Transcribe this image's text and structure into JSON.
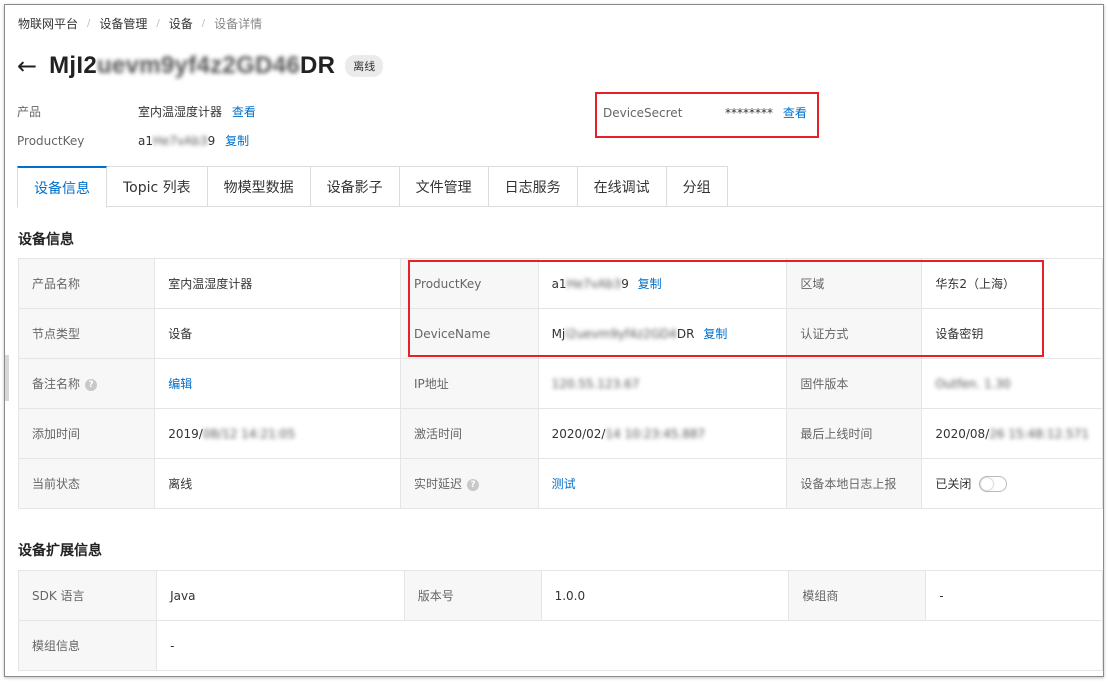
{
  "breadcrumb": [
    "物联网平台",
    "设备管理",
    "设备",
    "设备详情"
  ],
  "header": {
    "title_start": "MjI2",
    "title_blurred": "uevm9yf4z2GD46",
    "title_end": "DR",
    "status": "离线"
  },
  "meta": {
    "product_label": "产品",
    "product_value": "室内温湿度计器",
    "product_link": "查看",
    "productkey_label": "ProductKey",
    "productkey_value_start": "a1",
    "productkey_value_blurred": "He7vAb3",
    "productkey_value_end": "9",
    "productkey_link": "复制",
    "devicesecret_label": "DeviceSecret",
    "devicesecret_value": "********",
    "devicesecret_link": "查看"
  },
  "tabs": [
    "设备信息",
    "Topic 列表",
    "物模型数据",
    "设备影子",
    "文件管理",
    "日志服务",
    "在线调试",
    "分组"
  ],
  "device_info": {
    "title": "设备信息",
    "row1": {
      "l1": "产品名称",
      "v1": "室内温湿度计器",
      "l2": "ProductKey",
      "v2_start": "a1",
      "v2_blur": "He7vAb3",
      "v2_end": "9",
      "v2_link": "复制",
      "l3": "区域",
      "v3": "华东2（上海）"
    },
    "row2": {
      "l1": "节点类型",
      "v1": "设备",
      "l2": "DeviceName",
      "v2_start": "Mj",
      "v2_blur": "I2uevm9yf4z2GD4",
      "v2_end": "DR",
      "v2_link": "复制",
      "l3": "认证方式",
      "v3": "设备密钥"
    },
    "row3": {
      "l1": "备注名称",
      "v1": "编辑",
      "l2": "IP地址",
      "v2_blur": "120.55.123.67",
      "l3": "固件版本",
      "v3_blur": "Outfen. 1.30"
    },
    "row4": {
      "l1": "添加时间",
      "v1_start": "2019/",
      "v1_blur": "08/12 14:21:05",
      "l2": "激活时间",
      "v2_start": "2020/02/",
      "v2_blur": "14 10:23:45.887",
      "l3": "最后上线时间",
      "v3_start": "2020/08/",
      "v3_blur": "26 15:48:12.571"
    },
    "row5": {
      "l1": "当前状态",
      "v1": "离线",
      "l2": "实时延迟",
      "v2": "测试",
      "l3": "设备本地日志上报",
      "v3": "已关闭"
    }
  },
  "ext_info": {
    "title": "设备扩展信息",
    "row1": {
      "l1": "SDK 语言",
      "v1": "Java",
      "l2": "版本号",
      "v2": "1.0.0",
      "l3": "模组商",
      "v3": "-"
    },
    "row2": {
      "l1": "模组信息",
      "v1": "-"
    }
  }
}
